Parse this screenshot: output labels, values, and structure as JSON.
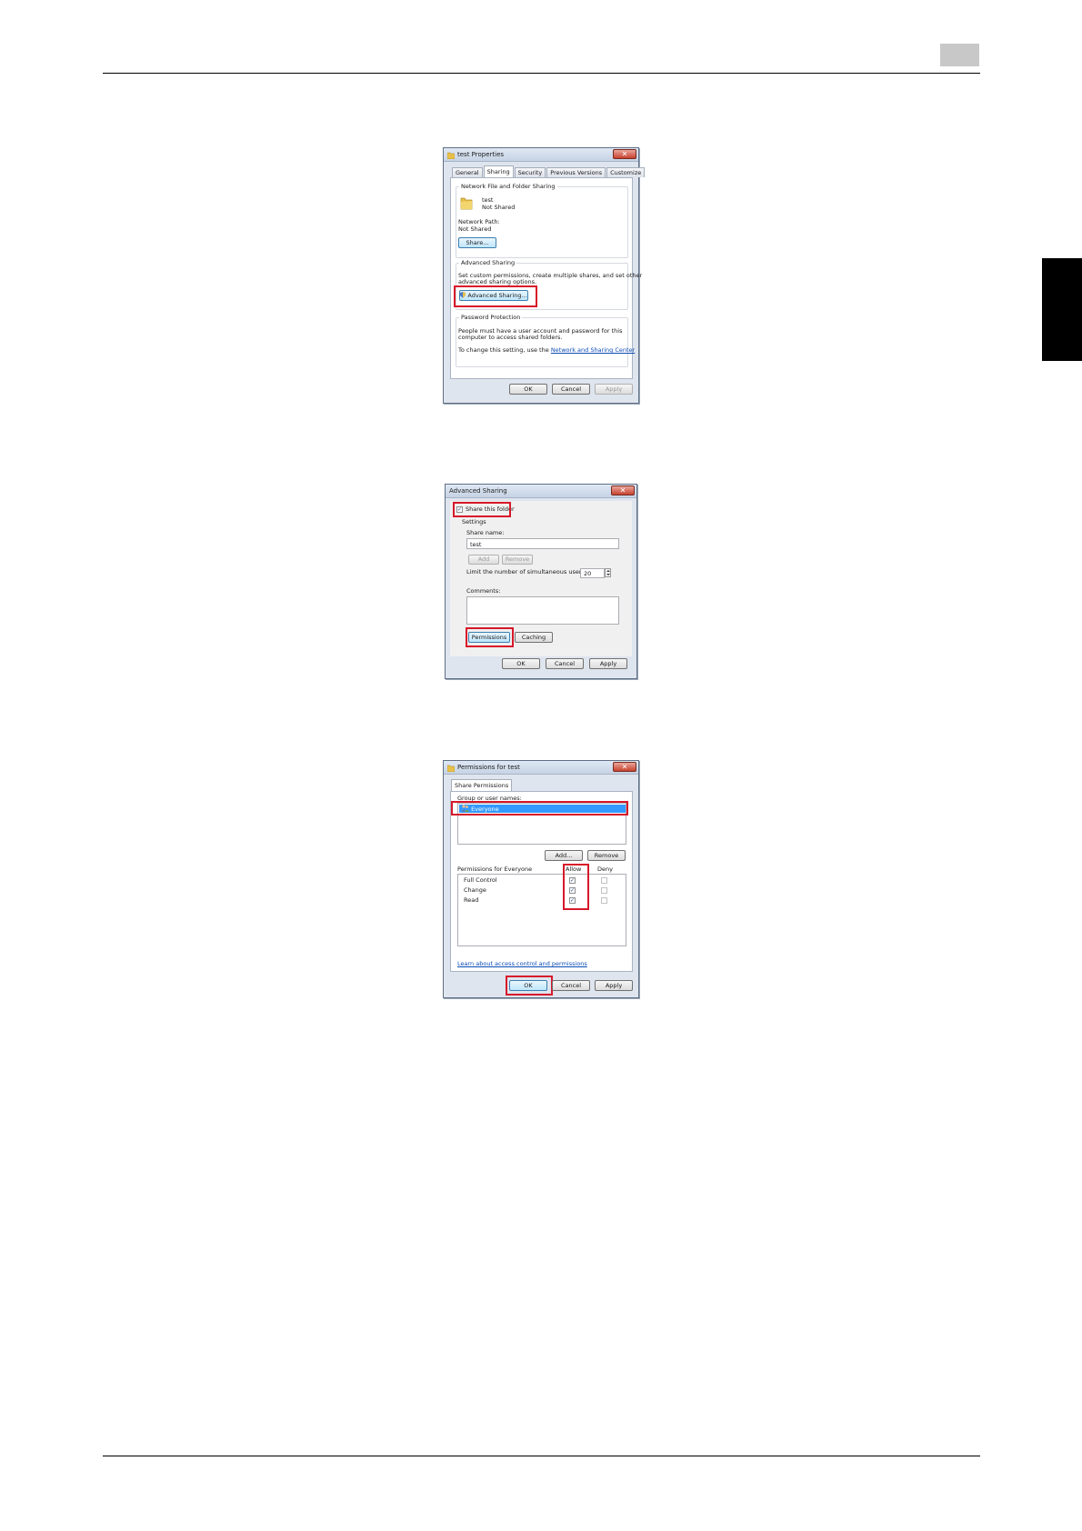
{
  "dialog1": {
    "title": "test Properties",
    "close_glyph": "✕",
    "icon": "folder-icon",
    "tabs": [
      "General",
      "Sharing",
      "Security",
      "Previous Versions",
      "Customize"
    ],
    "network_sharing": {
      "group_label": "Network File and Folder Sharing",
      "folder_name": "test",
      "folder_status": "Not Shared",
      "network_path_label": "Network Path:",
      "network_path_value": "Not Shared",
      "share_button": "Share..."
    },
    "advanced_sharing": {
      "group_label": "Advanced Sharing",
      "description_line1": "Set custom permissions, create multiple shares, and set other",
      "description_line2": "advanced sharing options.",
      "button": "Advanced Sharing..."
    },
    "password_protection": {
      "group_label": "Password Protection",
      "line1": "People must have a user account and password for this",
      "line2": "computer to access shared folders.",
      "change_prefix": "To change this setting, use the",
      "link": "Network and Sharing Center"
    },
    "buttons": {
      "ok": "OK",
      "cancel": "Cancel",
      "apply": "Apply"
    }
  },
  "dialog2": {
    "title": "Advanced Sharing",
    "close_glyph": "✕",
    "share_checkbox_label": "Share this folder",
    "share_checked_glyph": "✓",
    "settings_label": "Settings",
    "share_name_label": "Share name:",
    "share_name_value": "test",
    "add_button": "Add",
    "remove_button": "Remove",
    "limit_label": "Limit the number of simultaneous users to:",
    "limit_value": "20",
    "comments_label": "Comments:",
    "permissions_button": "Permissions",
    "caching_button": "Caching",
    "buttons": {
      "ok": "OK",
      "cancel": "Cancel",
      "apply": "Apply"
    }
  },
  "dialog3": {
    "title": "Permissions for test",
    "close_glyph": "✕",
    "icon": "folder-icon",
    "tab": "Share Permissions",
    "group_label": "Group or user names:",
    "users": [
      "Everyone"
    ],
    "user_icon": "group-users-icon",
    "add_button": "Add...",
    "remove_button": "Remove",
    "permissions_label": "Permissions for Everyone",
    "allow_header": "Allow",
    "deny_header": "Deny",
    "permissions": [
      {
        "name": "Full Control",
        "allow": true,
        "deny": false
      },
      {
        "name": "Change",
        "allow": true,
        "deny": false
      },
      {
        "name": "Read",
        "allow": true,
        "deny": false
      }
    ],
    "check_glyph": "✓",
    "learn_link": "Learn about access control and permissions",
    "buttons": {
      "ok": "OK",
      "cancel": "Cancel",
      "apply": "Apply"
    }
  },
  "colors": {
    "highlight": "#d7182a",
    "selection": "#3399ff",
    "link": "#0b4cb5",
    "side_tab": "#000000",
    "page_box": "#c8c8c8"
  }
}
